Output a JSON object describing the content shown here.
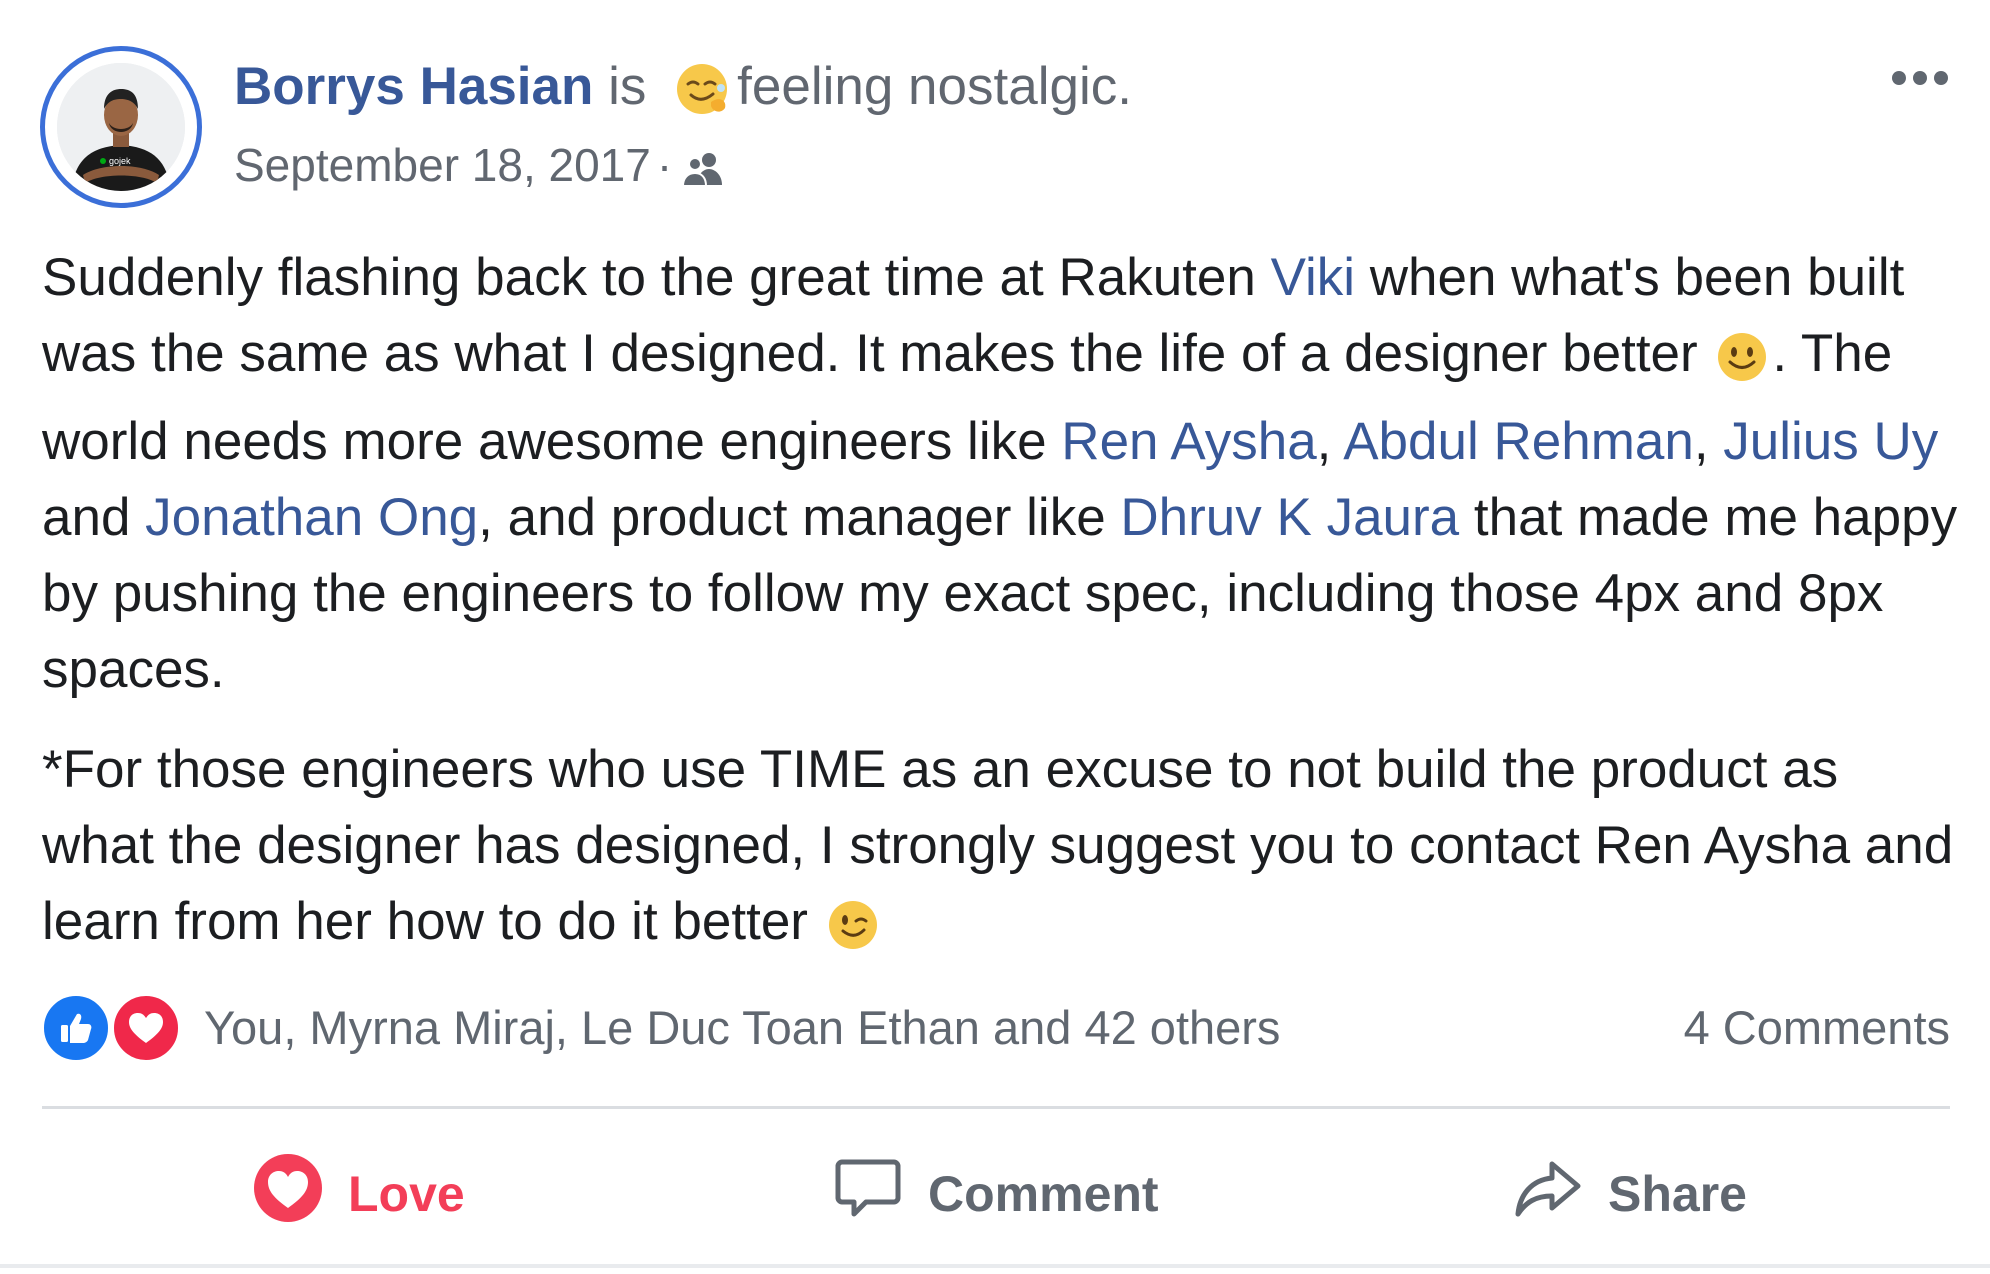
{
  "post": {
    "author": {
      "name": "Borrys Hasian",
      "connector": "is",
      "feeling": "feeling nostalgic.",
      "feeling_icon": "nostalgic-face-emoji",
      "avatar_shirt_text": "gojek"
    },
    "timestamp": "September 18, 2017",
    "meta_separator": "·",
    "audience_icon": "friends-icon",
    "more_icon": "more-options-icon",
    "paragraph1": {
      "t1": "Suddenly flashing back to the great time at Rakuten ",
      "tag_viki": "Viki",
      "t2": " when what's been built was the same as what I designed. It makes the life of a designer better ",
      "emoji_smile": "slightly-smiling-face-emoji",
      "t3": ". The world needs more awesome engineers like ",
      "tag_ren": "Ren Aysha",
      "c1": ", ",
      "tag_abdul": "Abdul Rehman",
      "c2": ", ",
      "tag_julius": "Julius Uy",
      "t4": " and ",
      "tag_jonathan": "Jonathan Ong",
      "t5": ", and product manager like ",
      "tag_dhruv": "Dhruv K Jaura",
      "t6": " that made me happy by pushing the engineers to follow my exact spec, including those 4px and 8px spaces."
    },
    "paragraph2": {
      "text": "*For those engineers who use TIME as an excuse to not build the product as what the designer has designed, I strongly suggest you to contact Ren Aysha and learn from her how to do it better ",
      "emoji_wink": "winking-face-emoji"
    },
    "reactions": {
      "icons": [
        "like-reaction-icon",
        "love-reaction-icon"
      ],
      "summary": "You, Myrna Miraj, Le Duc Toan Ethan and 42 others",
      "comments": "4 Comments"
    },
    "actions": {
      "love": "Love",
      "comment": "Comment",
      "share": "Share"
    },
    "colors": {
      "link": "#385898",
      "secondary_text": "#616770",
      "love_red": "#f33e58",
      "like_blue": "#1877f2",
      "avatar_ring": "#3b6fd8"
    }
  }
}
